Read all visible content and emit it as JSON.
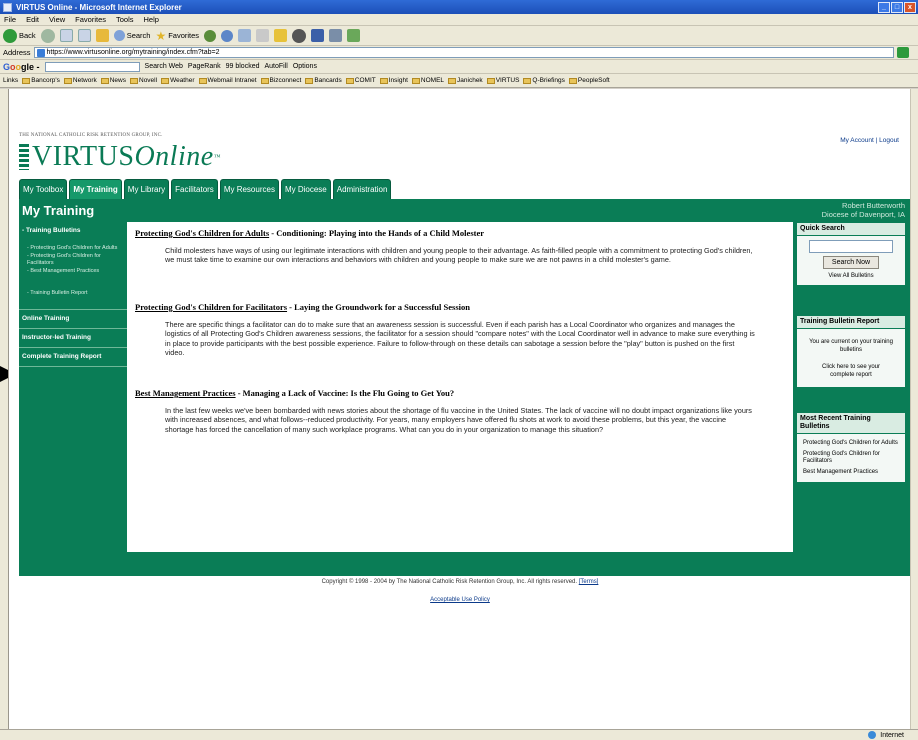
{
  "window": {
    "title": "VIRTUS Online - Microsoft Internet Explorer",
    "min": "_",
    "max": "□",
    "close": "x"
  },
  "menu": [
    "File",
    "Edit",
    "View",
    "Favorites",
    "Tools",
    "Help"
  ],
  "toolbar": {
    "back": "Back",
    "search": "Search",
    "favorites": "Favorites"
  },
  "address": {
    "label": "Address",
    "url": "https://www.virtusonline.org/mytraining/index.cfm?tab=2",
    "go": "Go"
  },
  "googlebar": {
    "logo_g": "G",
    "logo_o1": "o",
    "logo_o2": "o",
    "logo_rest": "gle -",
    "search_web": "Search Web",
    "pagerank": "PageRank",
    "blocked": "99 blocked",
    "autofill": "AutoFill",
    "options": "Options"
  },
  "links": {
    "label": "Links",
    "items": [
      "Bancorp's",
      "Network",
      "News",
      "Novell",
      "Weather",
      "Webmail Intranet",
      "Bizconnect",
      "Bancards",
      "COMIT",
      "Insight",
      "NOMEL",
      "Janichek",
      "VIRTUS",
      "Q-Briefings",
      "PeopleSoft"
    ]
  },
  "site": {
    "tagline": "THE NATIONAL CATHOLIC RISK RETENTION GROUP, INC.",
    "logo_main": "VIRTUS",
    "logo_italic": "Online",
    "logo_tm": "™",
    "account": "My Account",
    "logout": "Logout",
    "tabs": [
      "My Toolbox",
      "My Training",
      "My Library",
      "Facilitators",
      "My Resources",
      "My Diocese",
      "Administration"
    ],
    "page_title": "My Training",
    "user_name": "Robert Butterworth",
    "user_diocese": "Diocese of Davenport, IA"
  },
  "leftnav": {
    "training_bulletins": "- Training Bulletins",
    "sub1": "- Protecting God's Children for Adults",
    "sub2": "- Protecting God's Children for Facilitators",
    "sub3": "- Best Management Practices",
    "report": "- Training Bulletin Report",
    "online_training": "Online Training",
    "instructor_led": "Instructor-led Training",
    "complete_report": "Complete Training Report"
  },
  "articles": [
    {
      "link": "Protecting God's Children for Adults",
      "title": " - Conditioning: Playing into the Hands of a Child Molester",
      "body": "Child molesters have ways of using our legitimate interactions with children and young people to their advantage. As faith-filled people with a commitment to protecting God's children, we must take time to examine our own interactions and behaviors with children and young people to make sure we are not pawns in a child molester's game."
    },
    {
      "link": "Protecting God's Children for Facilitators",
      "title": " - Laying the Groundwork for a Successful Session",
      "body": "There are specific things a facilitator can do to make sure that an awareness session is successful. Even if each parish has a Local Coordinator who organizes and manages the logistics of all Protecting God's Children awareness sessions, the facilitator for a session should \"compare notes\" with the Local Coordinator well in advance to make sure everything is in place to provide participants with the best possible experience. Failure to follow-through on these details can sabotage a session before the \"play\" button is pushed on the first video."
    },
    {
      "link": "Best Management Practices",
      "title": " - Managing a Lack of Vaccine: Is the Flu Going to Get You?",
      "body": "In the last few weeks we've been bombarded with news stories about the shortage of flu vaccine in the United States. The lack of vaccine will no doubt impact organizations like yours with increased absences, and what follows--reduced productivity. For years, many employers have offered flu shots at work to avoid these problems, but this year, the vaccine shortage has forced the cancellation of many such workplace programs. What can you do in your organization to manage this situation?"
    }
  ],
  "quick_search": {
    "title": "Quick Search",
    "button": "Search Now",
    "view_all": "View All Bulletins"
  },
  "bulletin_report": {
    "title": "Training Bulletin Report",
    "status": "You are current on your training bulletins",
    "link": "Click here to see your complete report"
  },
  "recent": {
    "title": "Most Recent Training Bulletins",
    "items": [
      "Protecting God's Children for Adults",
      "Protecting God's Children for Facilitators",
      "Best Management Practices"
    ]
  },
  "footer": {
    "copyright": "Copyright © 1998 - 2004 by The National Catholic Risk Retention Group, Inc. All rights reserved.",
    "terms": "[Terms]",
    "policy": "Acceptable Use Policy"
  },
  "status": {
    "zone": "Internet"
  },
  "colors": {
    "brand_green": "#0a7d56",
    "active_tab": "#16996a",
    "ie_title": "#2f6bd6"
  }
}
